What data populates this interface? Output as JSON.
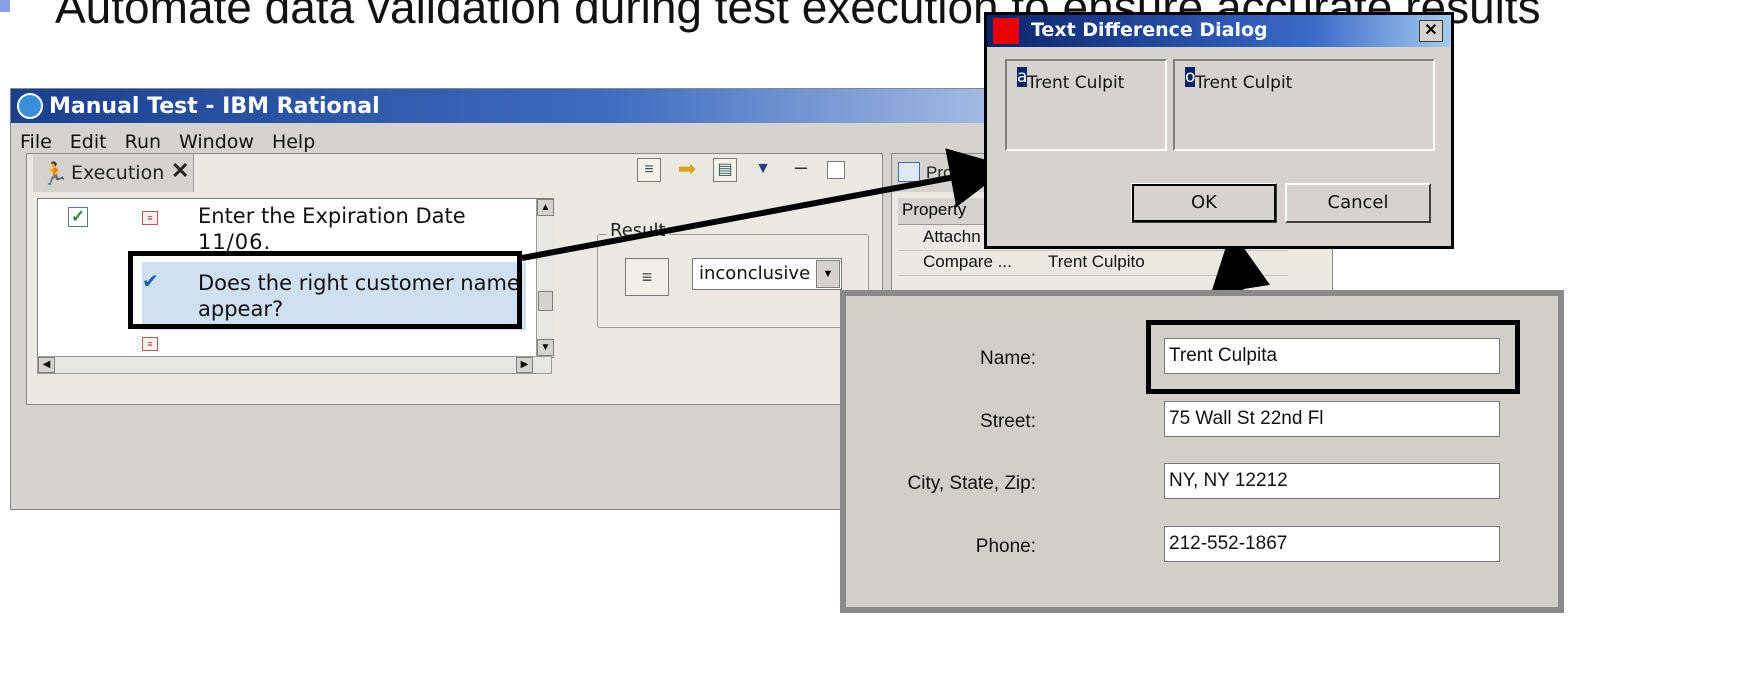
{
  "slide": {
    "headline": "Automate data validation during test execution to ensure accurate results"
  },
  "app": {
    "title": "Manual Test - IBM Rational",
    "menu": [
      "File",
      "Edit",
      "Run",
      "Window",
      "Help"
    ]
  },
  "execution": {
    "tab_label": "Execution",
    "steps": [
      {
        "text": "Enter the Expiration Date",
        "value": "11/06",
        "checked": true
      },
      {
        "text": "Does the right customer name appear?",
        "line1": "Does the right customer name",
        "line2": "appear?",
        "verified": true
      }
    ],
    "result": {
      "label": "Result",
      "value": "inconclusive"
    }
  },
  "properties": {
    "tab_label": "Prope",
    "header": "Property",
    "rows": [
      {
        "key": "Attachn",
        "value": ""
      },
      {
        "key": "Compare ...",
        "value": "Trent Culpito"
      }
    ]
  },
  "diff_dialog": {
    "title": "Text Difference Dialog",
    "left": {
      "prefix": "Trent Culpit",
      "highlight": "a"
    },
    "right": {
      "prefix": "Trent Culpit",
      "highlight": "o"
    },
    "ok_label": "OK",
    "cancel_label": "Cancel"
  },
  "form": {
    "fields": [
      {
        "label": "Name:",
        "value": "Trent Culpita"
      },
      {
        "label": "Street:",
        "value": "75 Wall St 22nd Fl"
      },
      {
        "label": "City, State, Zip:",
        "value": "NY, NY 12212"
      },
      {
        "label": "Phone:",
        "value": "212-552-1867"
      }
    ]
  }
}
